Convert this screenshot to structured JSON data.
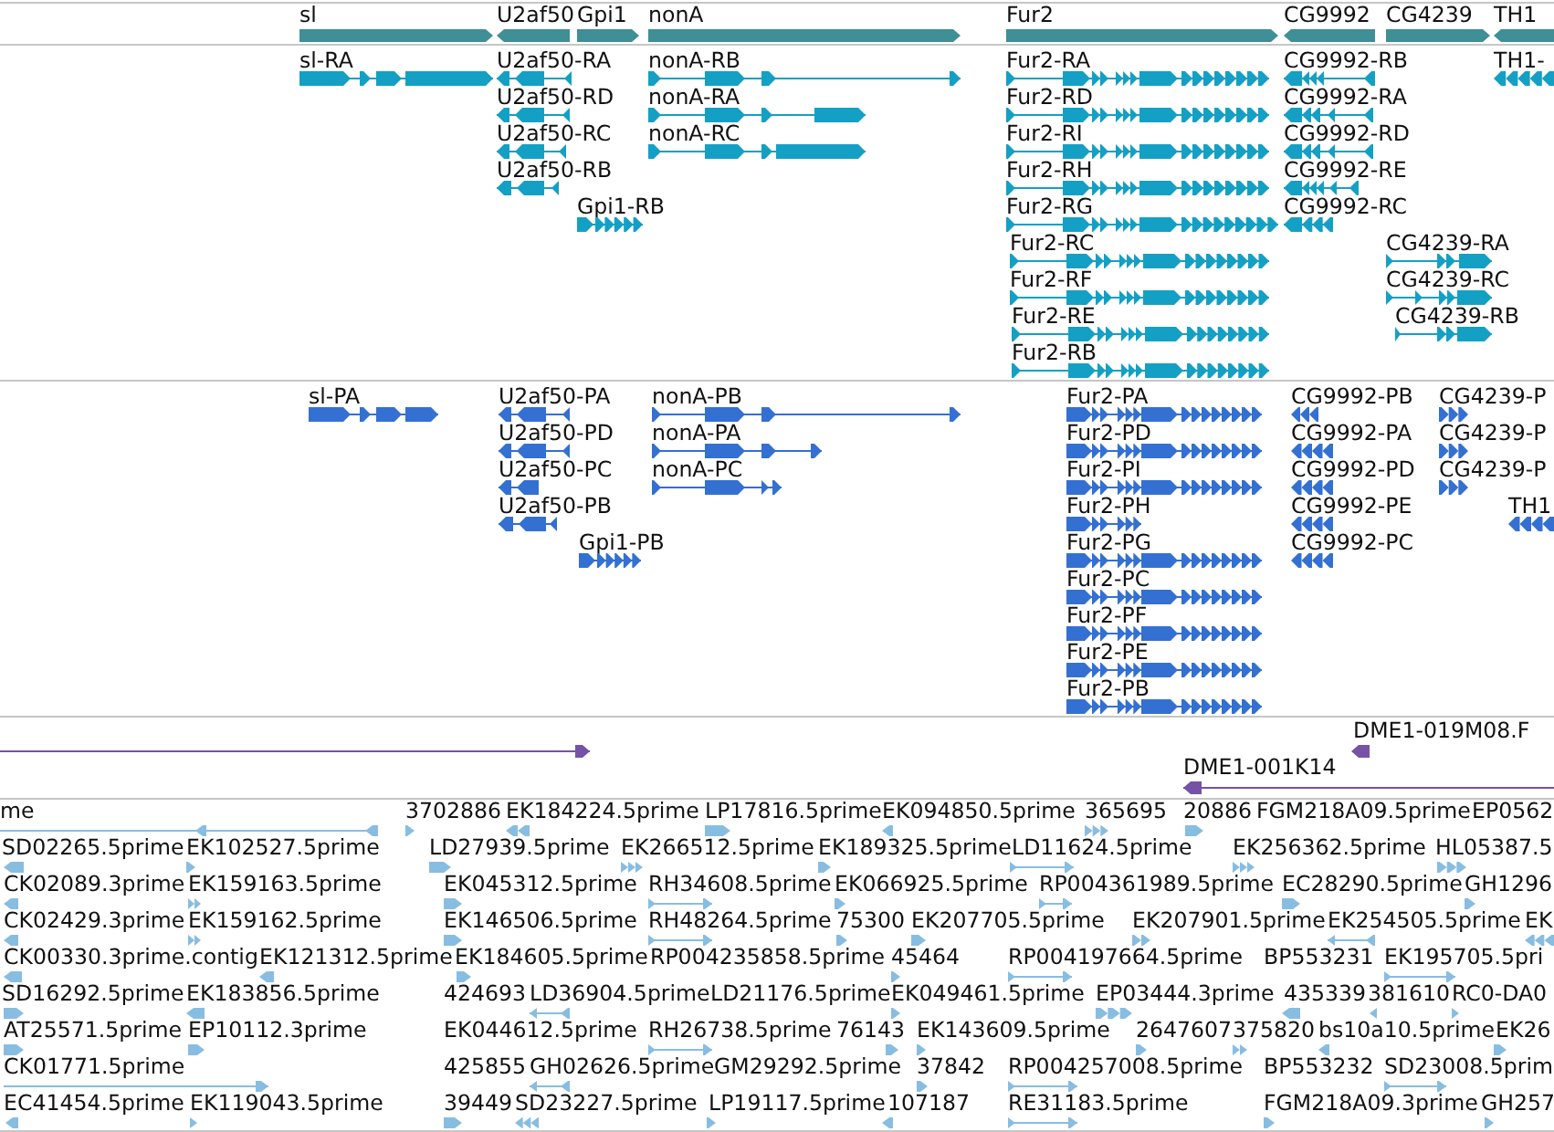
{
  "tracks": [
    {
      "kind": "genes",
      "features": [
        {
          "label": "sl",
          "reverse": false
        },
        {
          "label": "U2af50",
          "reverse": true
        },
        {
          "label": "Gpi1",
          "reverse": false
        },
        {
          "label": "nonA",
          "reverse": false
        },
        {
          "label": "Fur2",
          "reverse": false
        },
        {
          "label": "CG9992",
          "reverse": true
        },
        {
          "label": "CG4239",
          "reverse": false
        },
        {
          "label": "TH1",
          "reverse": true
        }
      ]
    },
    {
      "kind": "transcripts",
      "features": [
        {
          "label": "sl-RA",
          "reverse": false
        },
        {
          "label": "U2af50-RA",
          "reverse": true
        },
        {
          "label": "U2af50-RD",
          "reverse": true
        },
        {
          "label": "U2af50-RC",
          "reverse": true
        },
        {
          "label": "U2af50-RB",
          "reverse": true
        },
        {
          "label": "Gpi1-RB",
          "reverse": false
        },
        {
          "label": "nonA-RB",
          "reverse": false
        },
        {
          "label": "nonA-RA",
          "reverse": false
        },
        {
          "label": "nonA-RC",
          "reverse": false
        },
        {
          "label": "Fur2-RA",
          "reverse": false
        },
        {
          "label": "Fur2-RD",
          "reverse": false
        },
        {
          "label": "Fur2-RI",
          "reverse": false
        },
        {
          "label": "Fur2-RH",
          "reverse": false
        },
        {
          "label": "Fur2-RG",
          "reverse": false
        },
        {
          "label": "Fur2-RC",
          "reverse": false
        },
        {
          "label": "Fur2-RF",
          "reverse": false
        },
        {
          "label": "Fur2-RE",
          "reverse": false
        },
        {
          "label": "Fur2-RB",
          "reverse": false
        },
        {
          "label": "CG9992-RB",
          "reverse": true
        },
        {
          "label": "CG9992-RA",
          "reverse": true
        },
        {
          "label": "CG9992-RD",
          "reverse": true
        },
        {
          "label": "CG9992-RE",
          "reverse": true
        },
        {
          "label": "CG9992-RC",
          "reverse": true
        },
        {
          "label": "CG4239-RA",
          "reverse": false
        },
        {
          "label": "CG4239-RC",
          "reverse": false
        },
        {
          "label": "CG4239-RB",
          "reverse": false
        },
        {
          "label": "TH1-",
          "reverse": true
        }
      ]
    },
    {
      "kind": "proteins",
      "features": [
        {
          "label": "sl-PA",
          "reverse": false
        },
        {
          "label": "U2af50-PA",
          "reverse": true
        },
        {
          "label": "U2af50-PD",
          "reverse": true
        },
        {
          "label": "U2af50-PC",
          "reverse": true
        },
        {
          "label": "U2af50-PB",
          "reverse": true
        },
        {
          "label": "Gpi1-PB",
          "reverse": false
        },
        {
          "label": "nonA-PB",
          "reverse": false
        },
        {
          "label": "nonA-PA",
          "reverse": false
        },
        {
          "label": "nonA-PC",
          "reverse": false
        },
        {
          "label": "Fur2-PA",
          "reverse": false
        },
        {
          "label": "Fur2-PD",
          "reverse": false
        },
        {
          "label": "Fur2-PI",
          "reverse": false
        },
        {
          "label": "Fur2-PH",
          "reverse": false
        },
        {
          "label": "Fur2-PG",
          "reverse": false
        },
        {
          "label": "Fur2-PC",
          "reverse": false
        },
        {
          "label": "Fur2-PF",
          "reverse": false
        },
        {
          "label": "Fur2-PE",
          "reverse": false
        },
        {
          "label": "Fur2-PB",
          "reverse": false
        },
        {
          "label": "CG9992-PB",
          "reverse": true
        },
        {
          "label": "CG9992-PA",
          "reverse": true
        },
        {
          "label": "CG9992-PD",
          "reverse": true
        },
        {
          "label": "CG9992-PE",
          "reverse": true
        },
        {
          "label": "CG9992-PC",
          "reverse": true
        },
        {
          "label": "CG4239-P",
          "reverse": false
        },
        {
          "label": "CG4239-P",
          "reverse": false
        },
        {
          "label": "CG4239-P",
          "reverse": false
        },
        {
          "label": "TH1",
          "reverse": true
        }
      ]
    },
    {
      "kind": "clones",
      "features": [
        {
          "reverse": false
        },
        {
          "label": "DME1-019M08.F",
          "reverse": true
        },
        {
          "label": "DME1-001K14",
          "reverse": true
        }
      ]
    },
    {
      "kind": "ests",
      "features": [
        {
          "label": "me",
          "reverse": true
        },
        {
          "label": "3702886",
          "reverse": false
        },
        {
          "label": "EK184224.5prime",
          "reverse": true
        },
        {
          "label": "LP17816.5prime",
          "reverse": false
        },
        {
          "label": "EK094850.5prime",
          "reverse": true
        },
        {
          "label": "365695",
          "reverse": false
        },
        {
          "label": "20886",
          "reverse": false
        },
        {
          "label": "FGM218A09.5prime"
        },
        {
          "label": "EP0562"
        },
        {
          "label": "SD02265.5prime",
          "reverse": true
        },
        {
          "label": "EK102527.5prime",
          "reverse": false
        },
        {
          "label": "LD27939.5prime",
          "reverse": false
        },
        {
          "label": "EK266512.5prime",
          "reverse": false
        },
        {
          "label": "EK189325.5prime",
          "reverse": false
        },
        {
          "label": "LD11624.5prime",
          "reverse": false
        },
        {
          "label": "EK256362.5prime",
          "reverse": false
        },
        {
          "label": "HL05387.5",
          "reverse": false
        },
        {
          "label": "CK02089.3prime",
          "reverse": true
        },
        {
          "label": "EK159163.5prime",
          "reverse": false
        },
        {
          "label": "EK045312.5prime",
          "reverse": false
        },
        {
          "label": "RH34608.5prime",
          "reverse": false
        },
        {
          "label": "EK066925.5prime",
          "reverse": false
        },
        {
          "label": "RP004361989.5prime",
          "reverse": false
        },
        {
          "label": "EC28290.5prime",
          "reverse": false
        },
        {
          "label": "GH1296",
          "reverse": false
        },
        {
          "label": "CK02429.3prime",
          "reverse": true
        },
        {
          "label": "EK159162.5prime",
          "reverse": false
        },
        {
          "label": "EK146506.5prime",
          "reverse": false
        },
        {
          "label": "RH48264.5prime",
          "reverse": false
        },
        {
          "label": "75300",
          "reverse": false
        },
        {
          "label": "EK207705.5prime",
          "reverse": false
        },
        {
          "label": "EK207901.5prime",
          "reverse": false
        },
        {
          "label": "EK254505.5prime",
          "reverse": true
        },
        {
          "label": "EK",
          "reverse": true
        },
        {
          "label": "CK00330.3prime.contig",
          "reverse": true
        },
        {
          "label": "EK121312.5prime",
          "reverse": true
        },
        {
          "label": "EK184605.5prime",
          "reverse": false
        },
        {
          "label": "RP004235858.5prime"
        },
        {
          "label": "45464",
          "reverse": false
        },
        {
          "label": "RP004197664.5prime",
          "reverse": false
        },
        {
          "label": "BP553231"
        },
        {
          "label": "EK195705.5pri",
          "reverse": false
        },
        {
          "label": "SD16292.5prime",
          "reverse": false
        },
        {
          "label": "EK183856.5prime",
          "reverse": true
        },
        {
          "label": "424693"
        },
        {
          "label": "LD36904.5prime",
          "reverse": true
        },
        {
          "label": "LD21176.5prime"
        },
        {
          "label": "EK049461.5prime",
          "reverse": false
        },
        {
          "label": "EP03444.3prime",
          "reverse": false
        },
        {
          "label": "435339",
          "reverse": true
        },
        {
          "label": "381610",
          "reverse": true
        },
        {
          "label": "RC0-DA0",
          "reverse": false
        },
        {
          "label": "AT25571.5prime",
          "reverse": false
        },
        {
          "label": "EP10112.3prime",
          "reverse": false
        },
        {
          "label": "EK044612.5prime"
        },
        {
          "label": "RH26738.5prime",
          "reverse": false
        },
        {
          "label": "76143",
          "reverse": false
        },
        {
          "label": "EK143609.5prime",
          "reverse": false
        },
        {
          "label": "2647607",
          "reverse": false
        },
        {
          "label": "375820",
          "reverse": false
        },
        {
          "label": "bs10a10.5prime",
          "reverse": true
        },
        {
          "label": "EK26",
          "reverse": false
        },
        {
          "label": "CK01771.5prime",
          "reverse": false
        },
        {
          "label": "425855"
        },
        {
          "label": "GH02626.5prime",
          "reverse": true
        },
        {
          "label": "GM29292.5prime"
        },
        {
          "label": "37842",
          "reverse": false
        },
        {
          "label": "RP004257008.5prime",
          "reverse": false
        },
        {
          "label": "BP553232"
        },
        {
          "label": "SD23008.5prim",
          "reverse": false
        },
        {
          "label": "EC41454.5prime",
          "reverse": true
        },
        {
          "label": "EK119043.5prime",
          "reverse": false
        },
        {
          "label": "39449",
          "reverse": false
        },
        {
          "label": "SD23227.5prime",
          "reverse": true
        },
        {
          "label": "LP19117.5prime",
          "reverse": false
        },
        {
          "label": "107187",
          "reverse": true
        },
        {
          "label": "RE31183.5prime",
          "reverse": false
        },
        {
          "label": "FGM218A09.3prime",
          "reverse": false
        },
        {
          "label": "GH257",
          "reverse": false
        }
      ]
    }
  ]
}
